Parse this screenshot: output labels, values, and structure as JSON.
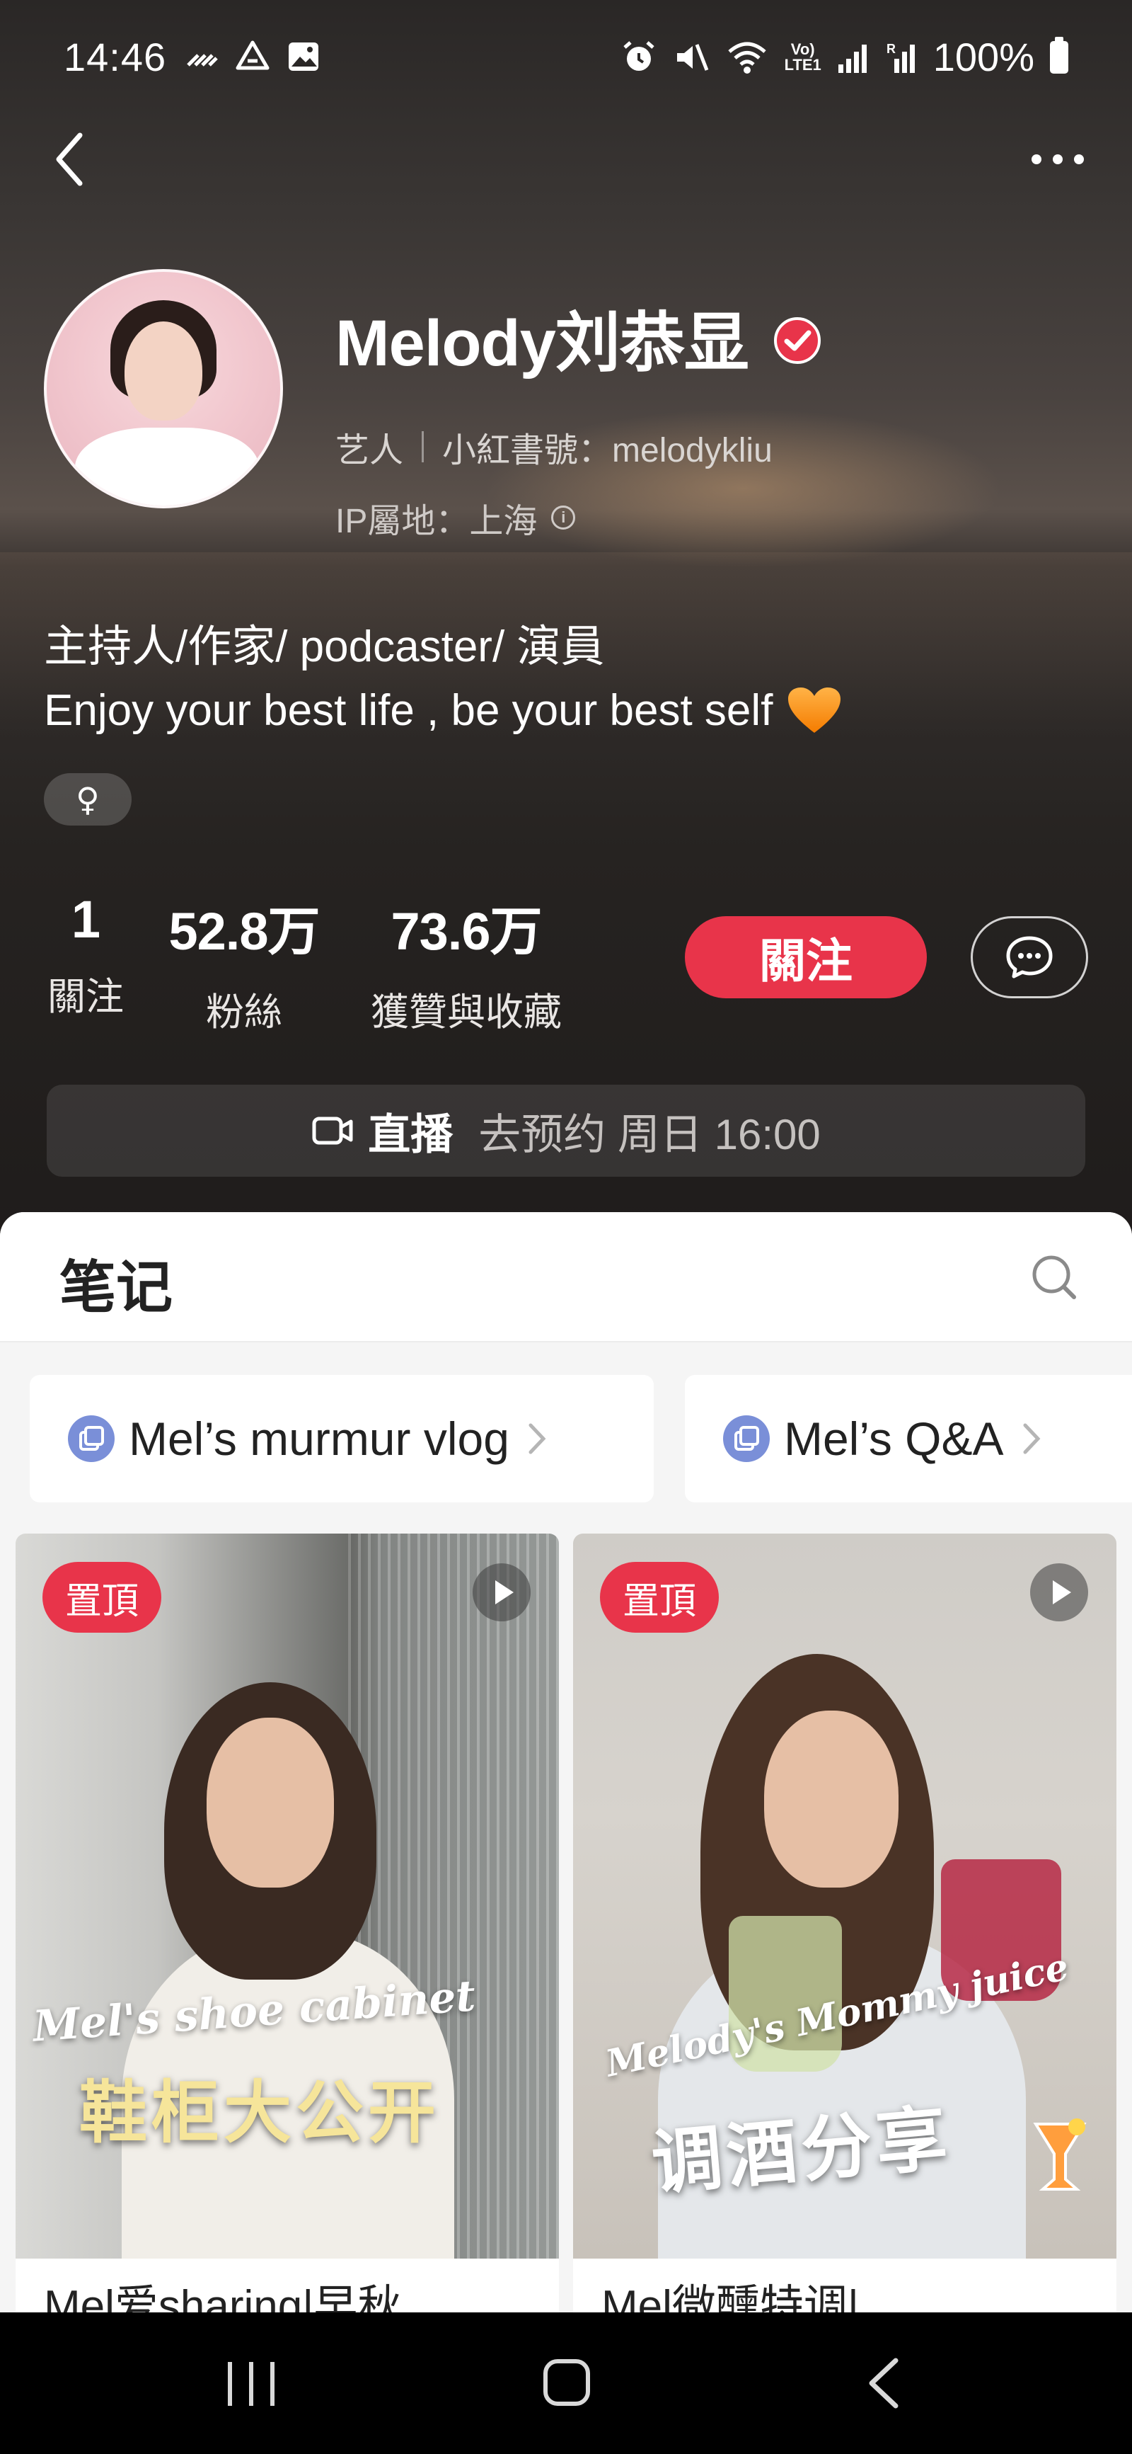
{
  "status_bar": {
    "time": "14:46",
    "network_label": "LTE1",
    "volte_label": "Vo)",
    "battery": "100%",
    "icons": [
      "data-saver-icon",
      "drive-icon",
      "gallery-icon",
      "alarm-icon",
      "mute-icon",
      "wifi-icon",
      "signal-icon",
      "signal-roaming-icon",
      "battery-icon"
    ]
  },
  "nav": {
    "back_icon": "chevron-left-icon",
    "more_icon": "more-dots-icon"
  },
  "profile": {
    "name": "Melody刘恭显",
    "verified": true,
    "role": "艺人",
    "rednote_id": "小紅書號：melodykliu",
    "ip_location": "IP屬地：上海",
    "bio_line_1": "主持人/作家/ podcaster/ 演員",
    "bio_line_2": "Enjoy your best life , be your best self",
    "gender_symbol": "♀"
  },
  "stats": [
    {
      "value": "1",
      "label": "關注"
    },
    {
      "value": "52.8万",
      "label": "粉絲"
    },
    {
      "value": "73.6万",
      "label": "獲贊與收藏"
    }
  ],
  "actions": {
    "follow": "關注",
    "message_icon": "chat-bubble-icon"
  },
  "live": {
    "label": "直播",
    "schedule": "去预约 周日 16:00"
  },
  "tabs": {
    "notes": "笔记"
  },
  "collections": [
    {
      "label": "Mel’s murmur vlog"
    },
    {
      "label": "Mel’s Q&A"
    }
  ],
  "posts": [
    {
      "pinned_label": "置頂",
      "cover_text_en": "Mel's shoe cabinet",
      "cover_text_zh": "鞋柜大公开",
      "title": "Mel爱sharing|早秋"
    },
    {
      "pinned_label": "置頂",
      "cover_text_en": "Melody's Mommy juice",
      "cover_text_zh": "调酒分享",
      "title": "Mel微醺特调|"
    }
  ],
  "colors": {
    "accent": "#e8344a",
    "sheet_bg": "#f5f5f5"
  }
}
